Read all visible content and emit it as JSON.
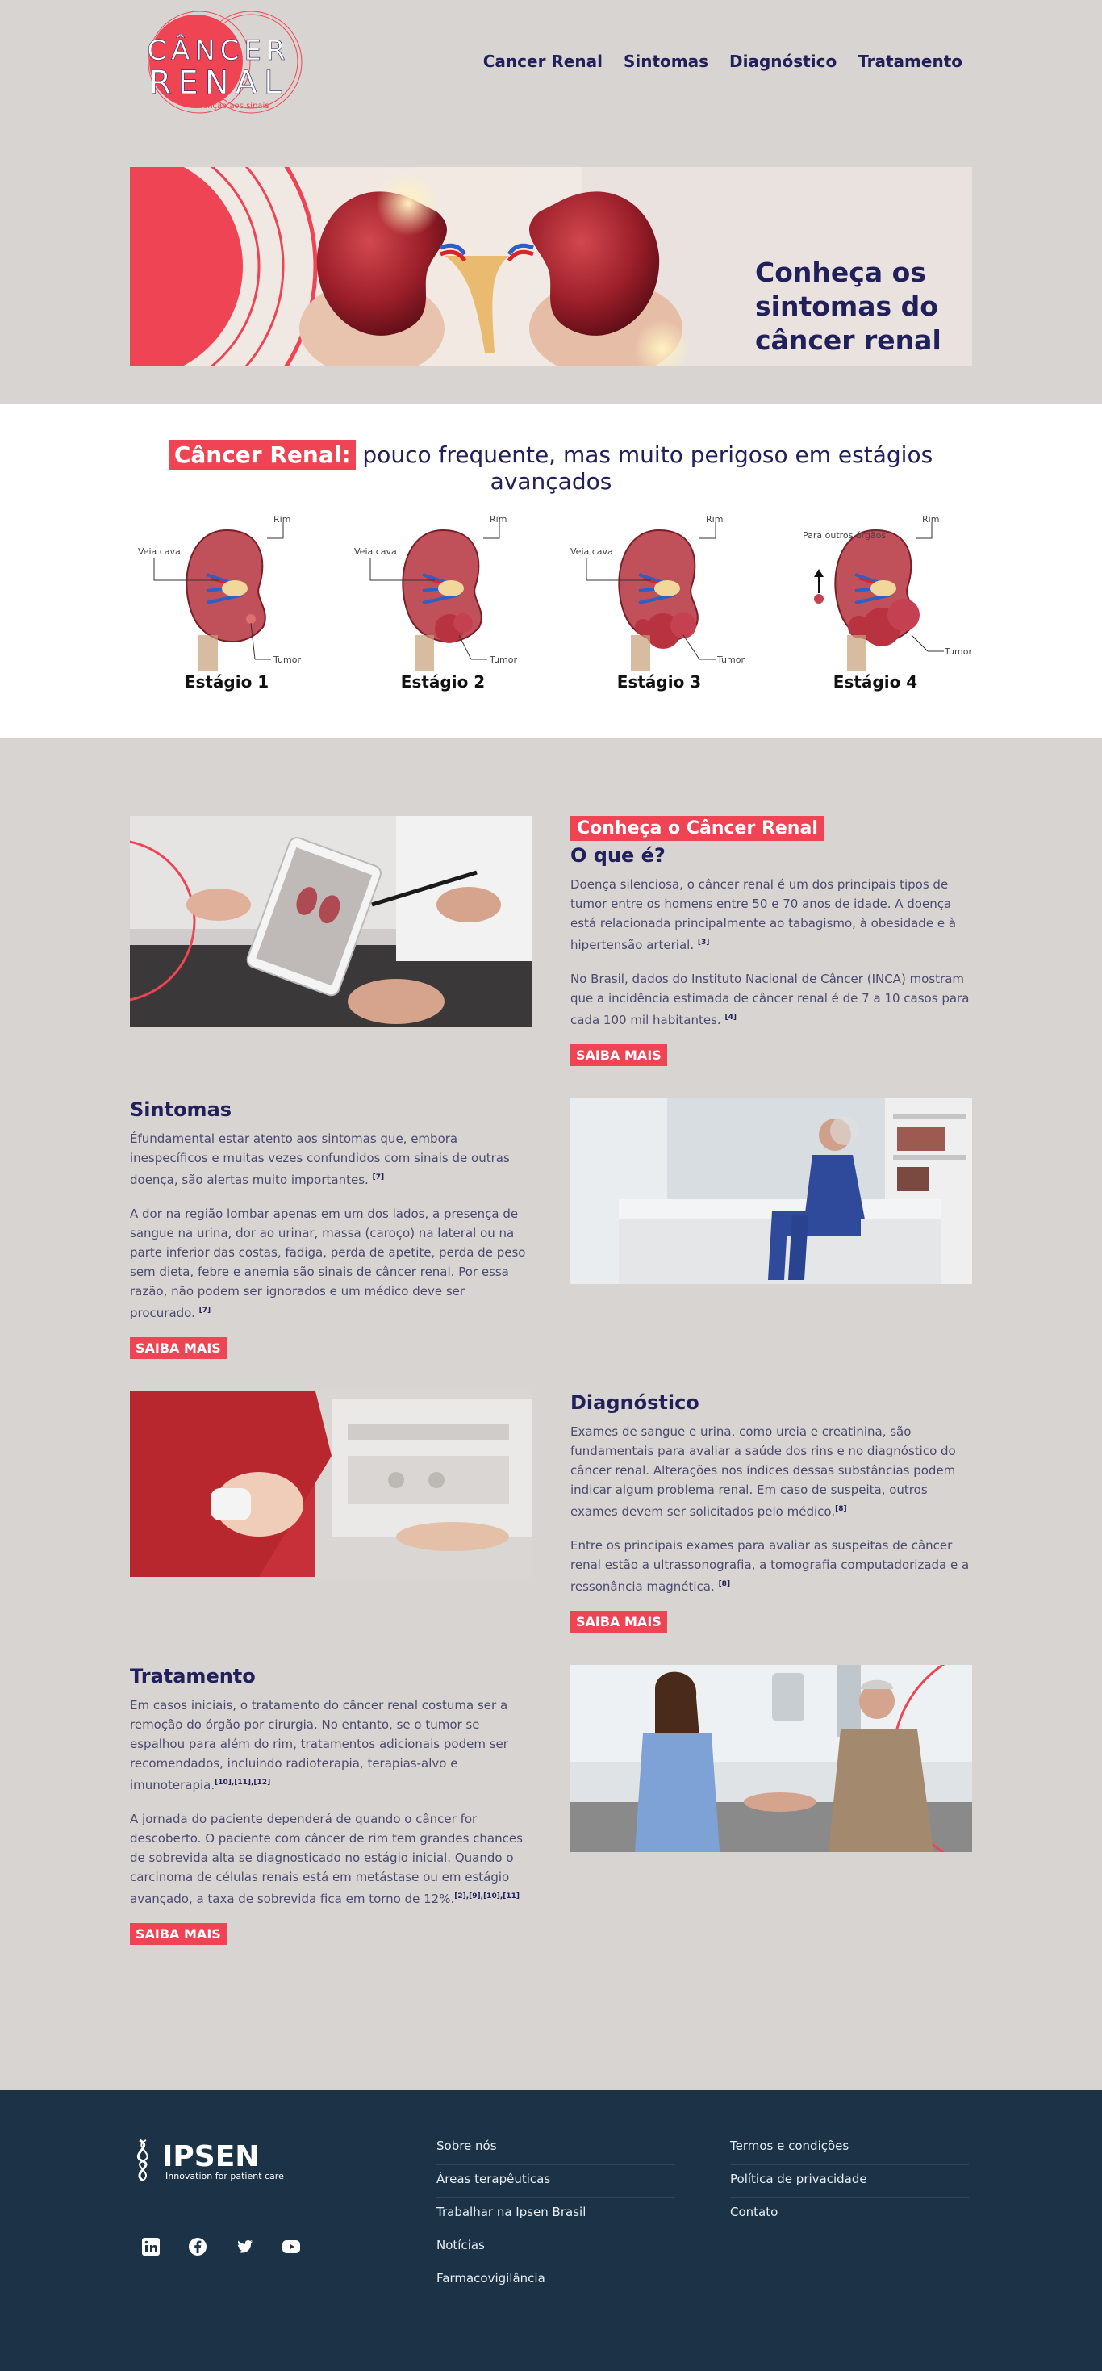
{
  "header": {
    "logo_line1": "CÂNCER",
    "logo_line2": "RENAL",
    "logo_tagline": "Atenção aos sinais",
    "nav": [
      "Cancer Renal",
      "Sintomas",
      "Diagnóstico",
      "Tratamento"
    ]
  },
  "hero": {
    "title": "Conheça os sintomas do câncer renal"
  },
  "stages": {
    "heading_highlight": "Câncer Renal:",
    "heading_rest": " pouco frequente, mas muito perigoso em estágios avançados",
    "label_vein": "Veia cava",
    "label_kidney": "Rim",
    "label_tumor": "Tumor",
    "label_organs": "Para outros órgãos",
    "items": [
      "Estágio 1",
      "Estágio 2",
      "Estágio 3",
      "Estágio 4"
    ]
  },
  "about": {
    "tag": "Conheça o Câncer Renal",
    "title": "O que é?",
    "p1": "Doença silenciosa, o câncer renal é um dos principais tipos de tumor entre os homens entre 50 e 70 anos de idade. A doença está relacionada principalmente ao tabagismo, à obesidade e à hipertensão arterial.",
    "p1_ref": "[3]",
    "p2": "No Brasil, dados do Instituto Nacional de Câncer (INCA) mostram que a incidência estimada de câncer renal é de 7 a 10 casos para cada 100 mil habitantes.",
    "p2_ref": "[4]",
    "button": "SAIBA MAIS"
  },
  "symptoms": {
    "title": "Sintomas",
    "p1": "Éfundamental estar atento aos sintomas que, embora inespecíficos e muitas vezes confundidos com sinais de outras doença, são alertas muito importantes.",
    "p1_ref": "[7]",
    "p2": "A dor na região lombar apenas em um dos lados, a presença de sangue na urina, dor ao urinar, massa (caroço) na lateral ou na parte inferior das costas, fadiga, perda de apetite, perda de peso sem dieta, febre e anemia são sinais de câncer renal. Por essa razão, não podem ser ignorados e um médico deve ser procurado.",
    "p2_ref": "[7]",
    "button": "SAIBA MAIS"
  },
  "diagnosis": {
    "title": "Diagnóstico",
    "p1": "Exames de sangue e urina, como ureia e creatinina, são fundamentais para avaliar a saúde dos rins e no diagnóstico do câncer renal. Alterações nos índices dessas substâncias podem indicar algum problema renal. Em caso de suspeita, outros exames devem ser solicitados pelo médico.",
    "p1_ref": "[8]",
    "p2": "Entre os principais exames para avaliar as suspeitas de câncer renal estão a ultrassonografia, a tomografia computadorizada e a ressonância magnética.",
    "p2_ref": "[8]",
    "button": "SAIBA MAIS"
  },
  "treatment": {
    "title": "Tratamento",
    "p1": "Em casos iniciais, o tratamento do câncer renal costuma ser a remoção do órgão por cirurgia. No entanto, se o tumor se espalhou para além do rim, tratamentos adicionais podem ser recomendados, incluindo radioterapia, terapias-alvo e imunoterapia.",
    "p1_ref": "[10],[11],[12]",
    "p2": "A jornada do paciente dependerá de quando o câncer for descoberto. O paciente com câncer de rim tem grandes chances de sobrevida alta se diagnosticado no estágio inicial. Quando o carcinoma de células renais está em metástase ou em estágio avançado, a taxa de sobrevida fica em torno de 12%.",
    "p2_ref": "[2],[9],[10],[11]",
    "button": "SAIBA MAIS"
  },
  "footer": {
    "brand": "IPSEN",
    "brand_tagline": "Innovation for patient care",
    "social": [
      "linkedin-icon",
      "facebook-icon",
      "twitter-icon",
      "youtube-icon"
    ],
    "col1": [
      "Sobre nós",
      "Áreas terapêuticas",
      "Trabalhar na Ipsen Brasil",
      "Notícias",
      "Farmacovigilância"
    ],
    "col2": [
      "Termos e condições",
      "Política de privacidade",
      "Contato"
    ]
  },
  "colors": {
    "accent": "#ef4454",
    "navy": "#22205a",
    "footer": "#1c3347",
    "background": "#d8d4d1"
  }
}
